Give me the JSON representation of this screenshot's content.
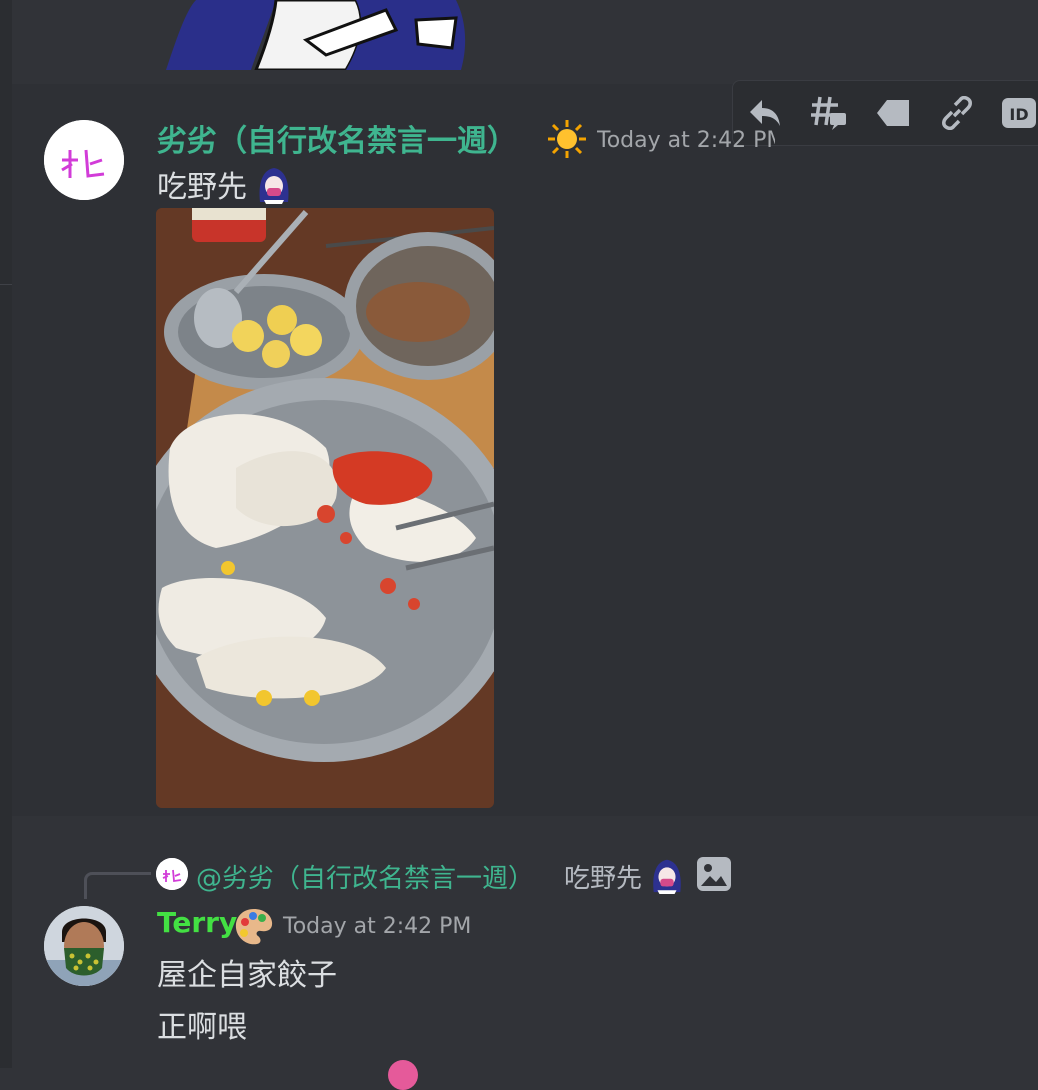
{
  "messages": [
    {
      "author": "劣劣（自行改名禁言一週）",
      "author_color": "#3fb58f",
      "badge_icon": "sun-icon",
      "timestamp": "Today at 2:42 PM",
      "text": "吃野先",
      "has_image": true
    },
    {
      "author": "Terry",
      "author_color": "#43e043",
      "badge_icon": "palette-icon",
      "timestamp": "Today at 2:42 PM",
      "lines": [
        "屋企自家餃子",
        "正啊喂"
      ],
      "reply": {
        "author": "@劣劣（自行改名禁言一週）",
        "text": "吃野先"
      }
    }
  ],
  "toolbar": {
    "icons": [
      "reply-icon",
      "create-thread-icon",
      "tag-icon",
      "copy-link-icon",
      "copy-id-icon"
    ],
    "id_label": "ID"
  }
}
